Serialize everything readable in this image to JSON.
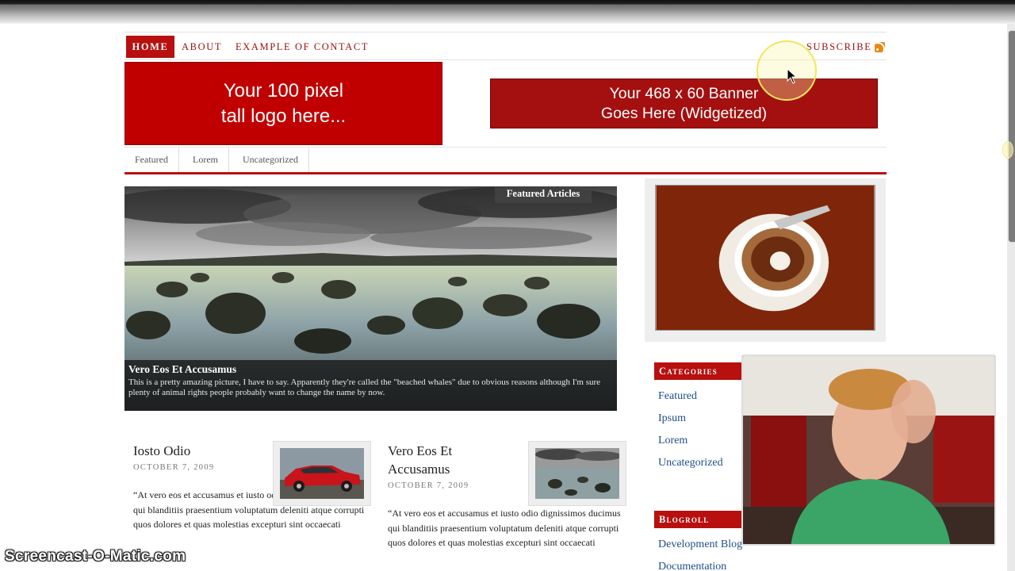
{
  "nav": {
    "home": "Home",
    "about": "About",
    "contact": "Example of Contact",
    "subscribe": "Subscribe",
    "rss_icon": "rss-icon"
  },
  "logo": {
    "line1": "Your 100 pixel",
    "line2": "tall logo here..."
  },
  "banner": {
    "line1": "Your 468 x 60 Banner",
    "line2": "Goes Here (Widgetized)"
  },
  "categories_nav": [
    "Featured",
    "Lorem",
    "Uncategorized"
  ],
  "featured": {
    "tag": "Featured Articles",
    "title": "Vero Eos Et Accusamus",
    "text": "This is a pretty amazing picture, I have to say. Apparently they're called the \"beached whales\" due to obvious reasons although I'm sure plenty of animal rights people probably want to change the name by now."
  },
  "posts": [
    {
      "title": "Iosto Odio",
      "date": "October 7, 2009",
      "excerpt": "“At vero eos et accusamus et iusto odio dignissimos ducimus qui blanditiis praesentium voluptatum deleniti atque corrupti quos dolores et quas molestias excepturi sint occaecati"
    },
    {
      "title": "Vero Eos Et Accusamus",
      "date": "October 7, 2009",
      "excerpt": "“At vero eos et accusamus et iusto odio dignissimos ducimus qui blanditiis praesentium voluptatum deleniti atque corrupti quos dolores et quas molestias excepturi sint occaecati"
    }
  ],
  "sidebar": {
    "categories_title": "Categories",
    "categories": [
      "Featured",
      "Ipsum",
      "Lorem",
      "Uncategorized"
    ],
    "blogroll_title": "Blogroll",
    "blogroll": [
      "Development Blog",
      "Documentation"
    ]
  },
  "watermark": "Screencast-O-Matic.com",
  "colors": {
    "accent": "#b80f0f",
    "link": "#1f4d8a"
  }
}
